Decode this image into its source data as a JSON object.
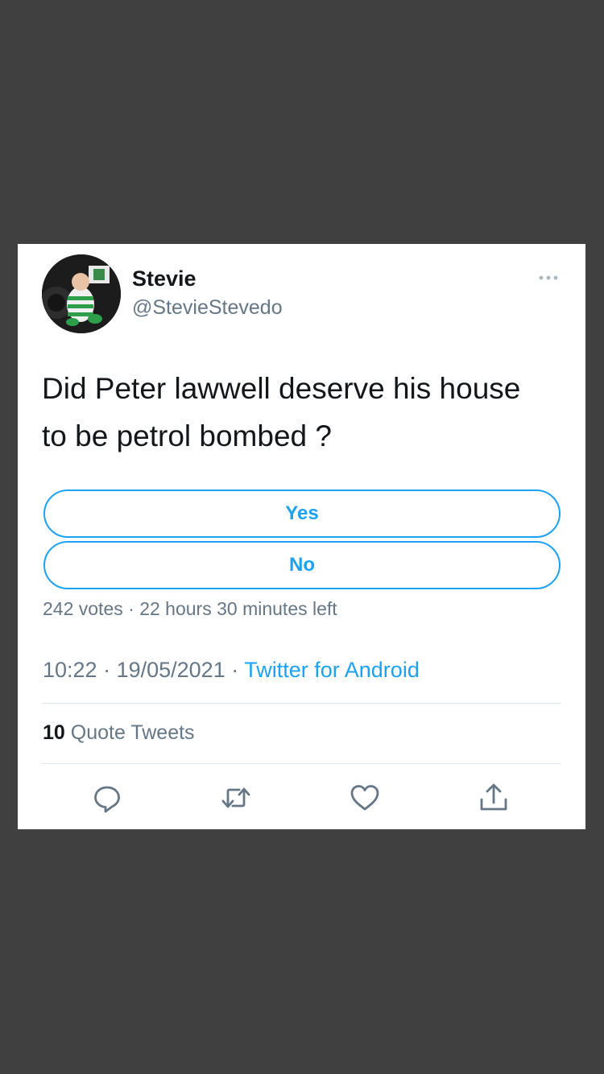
{
  "tweet": {
    "author_name": "Stevie",
    "author_handle": "@StevieStevedo",
    "text_line1": "Did Peter lawwell deserve his house",
    "text_line2": "to be petrol bombed ?",
    "more_icon": "more-dots-icon"
  },
  "poll": {
    "options": [
      {
        "label": "Yes"
      },
      {
        "label": "No"
      }
    ],
    "votes": "242 votes",
    "separator": " · ",
    "time_left": "22 hours 30 minutes left"
  },
  "meta": {
    "time": "10:22",
    "separator": " · ",
    "date": "19/05/2021",
    "source": "Twitter for Android"
  },
  "stats": {
    "quote_count": "10",
    "quote_label": " Quote Tweets"
  },
  "actions": [
    "reply-icon",
    "retweet-icon",
    "like-icon",
    "share-icon"
  ],
  "colors": {
    "accent": "#1da1f2",
    "text": "#14171a",
    "muted": "#657786",
    "backdrop": "#404040"
  }
}
